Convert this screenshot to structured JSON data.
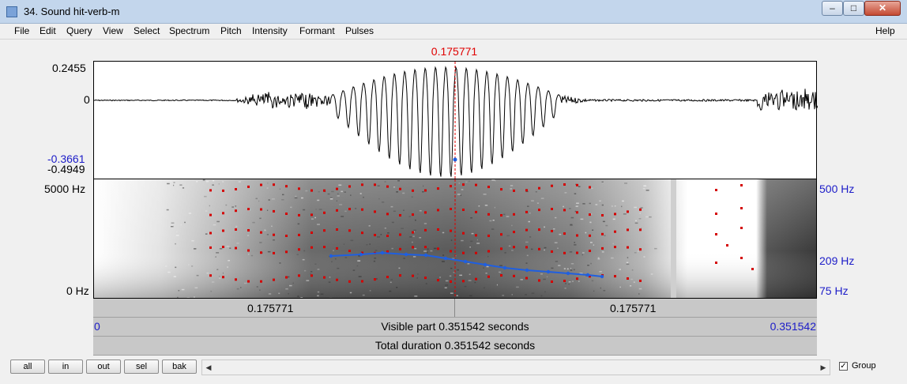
{
  "window": {
    "title": "34. Sound hit-verb-m",
    "minimize_glyph": "–",
    "maximize_glyph": "□",
    "close_glyph": "✕"
  },
  "menu": {
    "items": [
      "File",
      "Edit",
      "Query",
      "View",
      "Select",
      "Spectrum",
      "Pitch",
      "Intensity",
      "Formant",
      "Pulses"
    ],
    "help": "Help"
  },
  "cursor": {
    "time": "0.175771",
    "color": "#e00000"
  },
  "waveform": {
    "max_label": "0.2455",
    "zero_label": "0",
    "cursor_value": "-0.3661",
    "min_label": "-0.4949"
  },
  "spectrogram": {
    "top_label": "5000 Hz",
    "bottom_label": "0 Hz",
    "pitch_top": "500 Hz",
    "pitch_cursor": "209 Hz",
    "pitch_bottom": "75 Hz",
    "formant_color": "#d40000",
    "pitch_color": "#1f5fe0"
  },
  "time_bars": {
    "left_segment": "0.175771",
    "right_segment": "0.175771",
    "visible_start": "0",
    "visible_label": "Visible part 0.351542 seconds",
    "visible_end": "0.351542",
    "total_label": "Total duration 0.351542 seconds"
  },
  "bottom": {
    "buttons": [
      "all",
      "in",
      "out",
      "sel",
      "bak"
    ],
    "left_arrow": "◀",
    "right_arrow": "▶",
    "group_label": "Group",
    "group_checked": "✓"
  }
}
